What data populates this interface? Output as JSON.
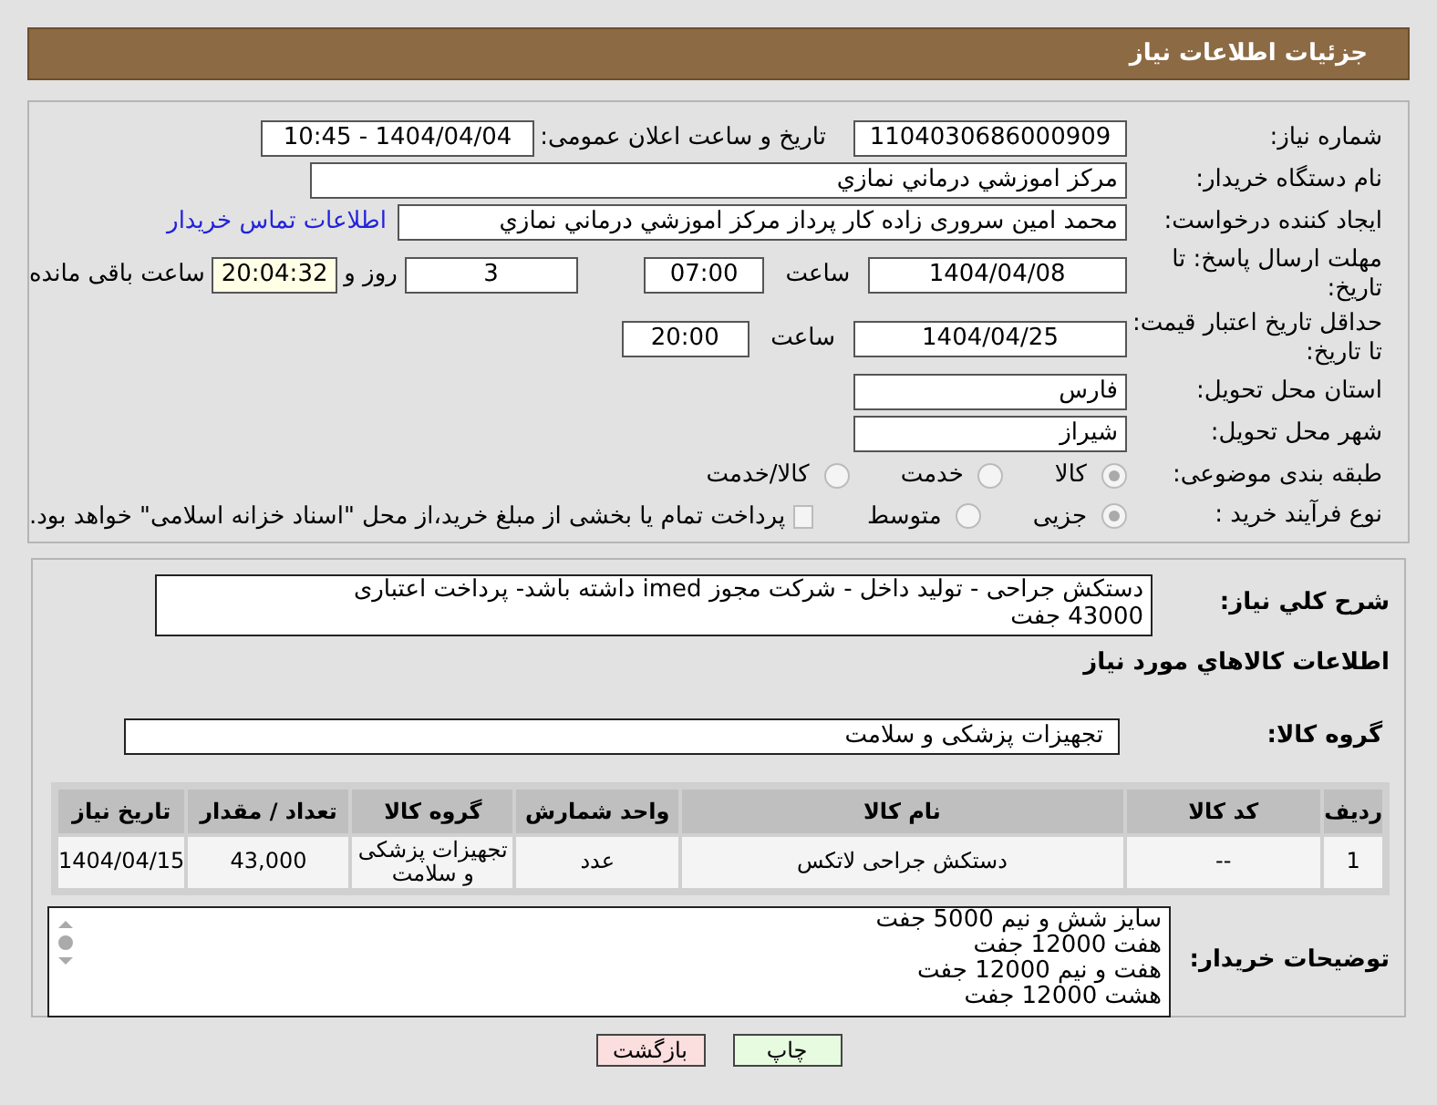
{
  "header": {
    "title": "جزئیات اطلاعات نیاز"
  },
  "need_number": {
    "label": "شماره نیاز:",
    "value": "1104030686000909"
  },
  "announce": {
    "label": "تاریخ و ساعت اعلان عمومی:",
    "value": "1404/04/04 - 10:45"
  },
  "buyer_org": {
    "label": "نام دستگاه خریدار:",
    "value": "مرکز اموزشي درماني نمازي"
  },
  "creator": {
    "label": "ایجاد کننده درخواست:",
    "value": "محمد امین سروری زاده کار پرداز مرکز اموزشي درماني نمازي",
    "link": "اطلاعات تماس خریدار"
  },
  "deadline": {
    "label": "مهلت ارسال پاسخ: تا تاریخ:",
    "date": "1404/04/08",
    "time_label": "ساعت",
    "time": "07:00",
    "days": "3",
    "days_label": "روز و",
    "remaining": "20:04:32",
    "remaining_label": "ساعت باقی مانده"
  },
  "validity": {
    "label": "حداقل تاریخ اعتبار قیمت: تا تاریخ:",
    "date": "1404/04/25",
    "time_label": "ساعت",
    "time": "20:00"
  },
  "province": {
    "label": "استان محل تحویل:",
    "value": "فارس"
  },
  "city": {
    "label": "شهر محل تحویل:",
    "value": "شیراز"
  },
  "category": {
    "label": "طبقه بندی موضوعی:",
    "options": [
      {
        "label": "کالا",
        "selected": true
      },
      {
        "label": "خدمت",
        "selected": false
      },
      {
        "label": "کالا/خدمت",
        "selected": false
      }
    ]
  },
  "process": {
    "label": "نوع فرآیند خرید :",
    "options": [
      {
        "label": "جزیی",
        "selected": true
      },
      {
        "label": "متوسط",
        "selected": false
      }
    ],
    "treasury": {
      "checked": false,
      "text": "پرداخت تمام یا بخشی از مبلغ خرید،از محل \"اسناد خزانه اسلامی\" خواهد بود."
    }
  },
  "description": {
    "label": "شرح کلي نياز:",
    "lines": [
      "دستکش جراحی - تولید داخل - شرکت مجوز imed داشته باشد- پرداخت اعتباری",
      "43000 جفت"
    ]
  },
  "items_heading": "اطلاعات کالاهاي مورد نياز",
  "goods_group": {
    "label": "گروه کالا:",
    "value": "تجهیزات پزشکی و سلامت"
  },
  "table": {
    "columns": [
      "ردیف",
      "کد کالا",
      "نام کالا",
      "واحد شمارش",
      "گروه کالا",
      "تعداد / مقدار",
      "تاریخ نیاز"
    ],
    "rows": [
      [
        "1",
        "--",
        "دستکش جراحی لاتکس",
        "عدد",
        "تجهیزات پزشکی و سلامت",
        "43,000",
        "1404/04/15"
      ]
    ]
  },
  "buyer_notes": {
    "label": "توضیحات خریدار:",
    "lines": [
      "سایز شش و نیم 5000 جفت",
      "هفت 12000 جفت",
      "هفت و نیم 12000 جفت",
      "هشت 12000 جفت"
    ]
  },
  "buttons": [
    {
      "label": "چاپ",
      "kind": "print"
    },
    {
      "label": "بازگشت",
      "kind": "back"
    }
  ]
}
